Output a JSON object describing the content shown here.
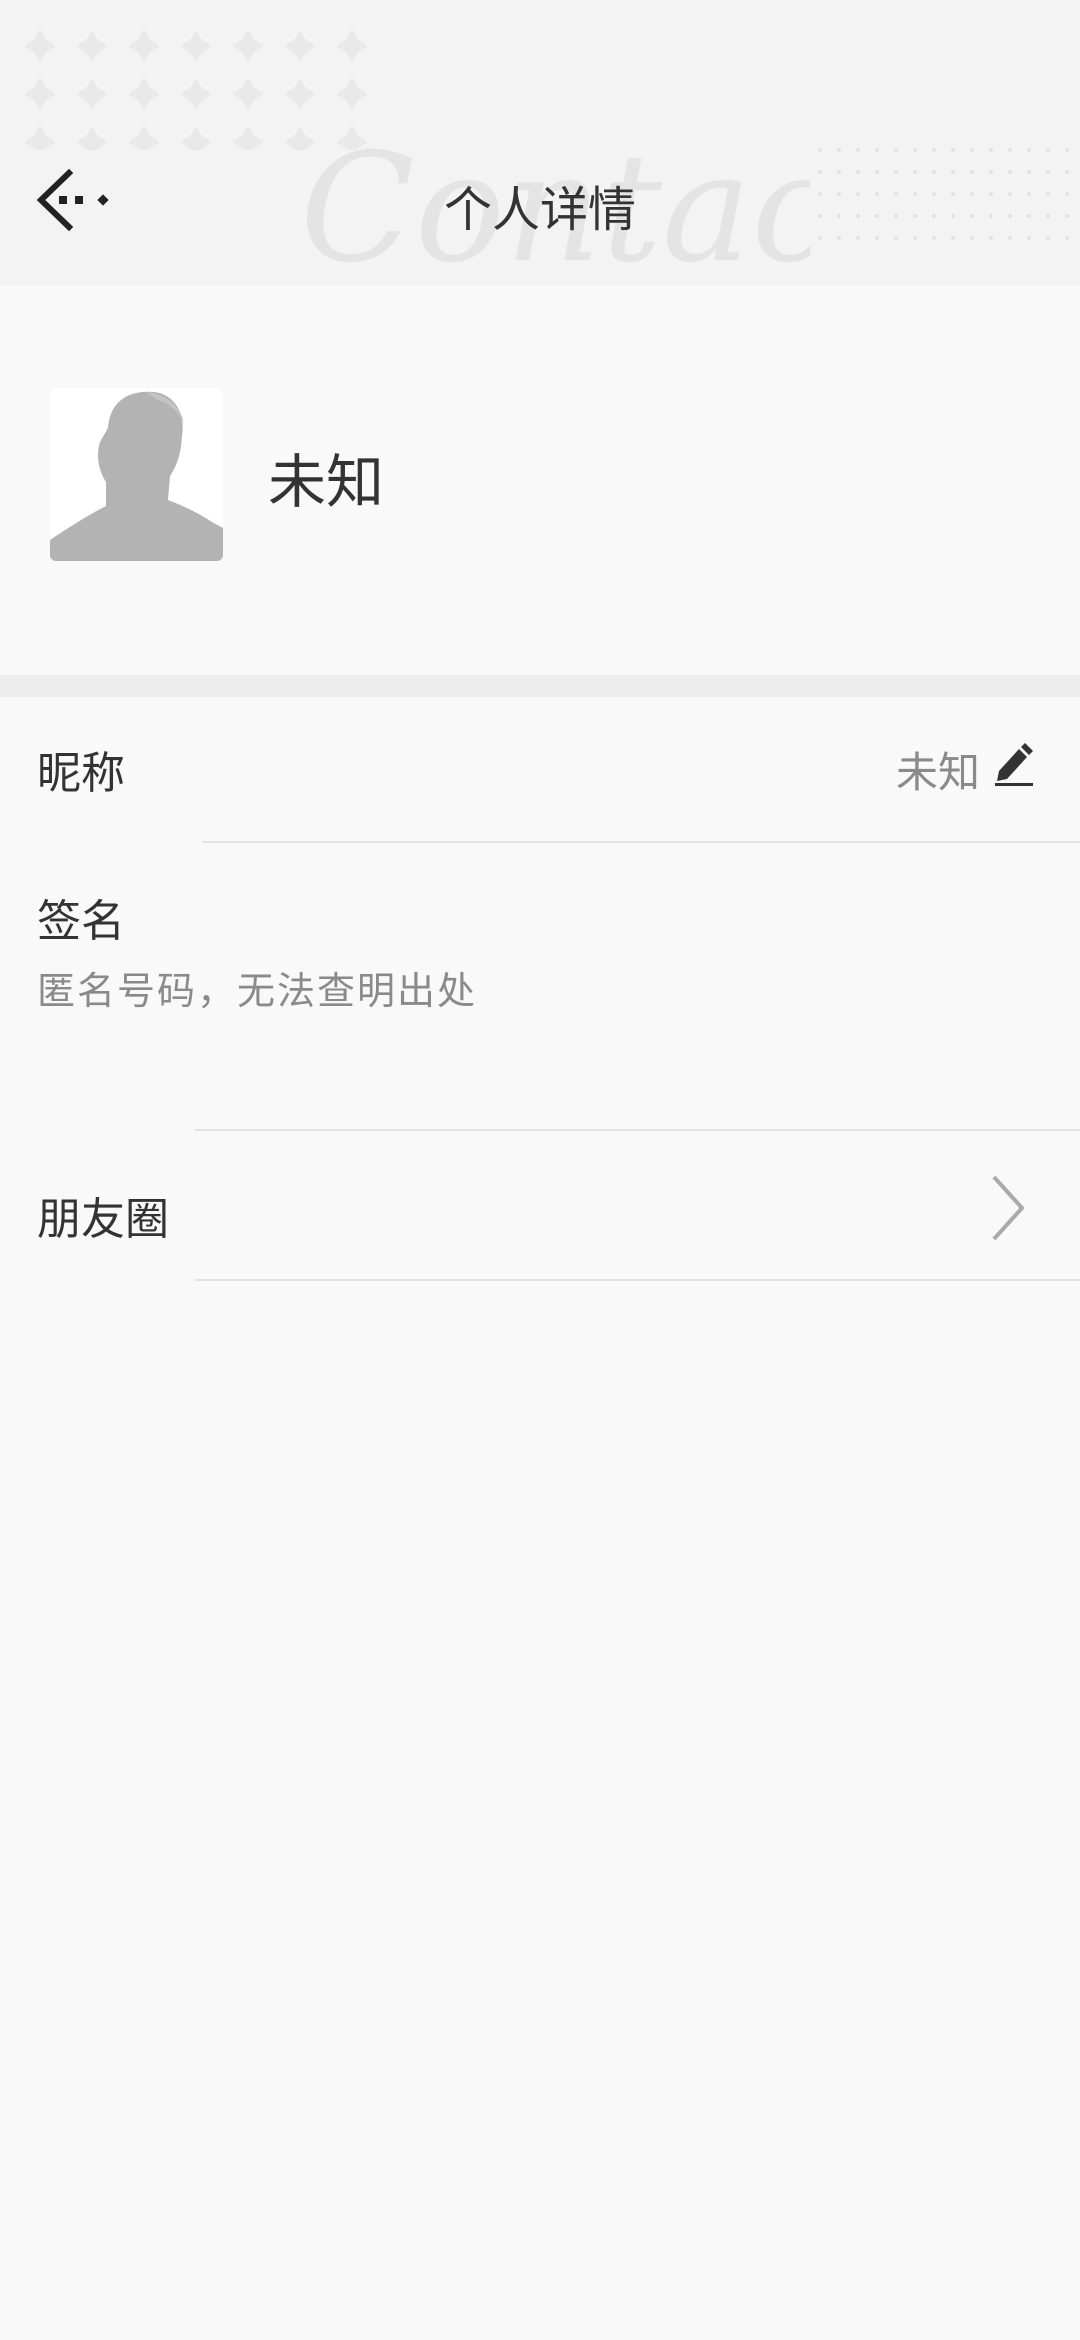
{
  "header": {
    "title": "个人详情",
    "watermark_text": "Contacts",
    "back_icon": "back-arrow-icon"
  },
  "profile": {
    "avatar_icon": "default-person-avatar",
    "name": "未知"
  },
  "nickname_row": {
    "label": "昵称",
    "value": "未知",
    "edit_icon": "pencil-icon"
  },
  "signature_row": {
    "label": "签名",
    "text": "匿名号码，无法查明出处"
  },
  "moments_row": {
    "label": "朋友圈",
    "icon": "chevron-right-icon"
  },
  "colors": {
    "background": "#f9f9f9",
    "header_background": "#f3f3f3",
    "primary_text": "#333333",
    "secondary_text": "#8a8a8a",
    "divider": "#e3e3e3"
  }
}
